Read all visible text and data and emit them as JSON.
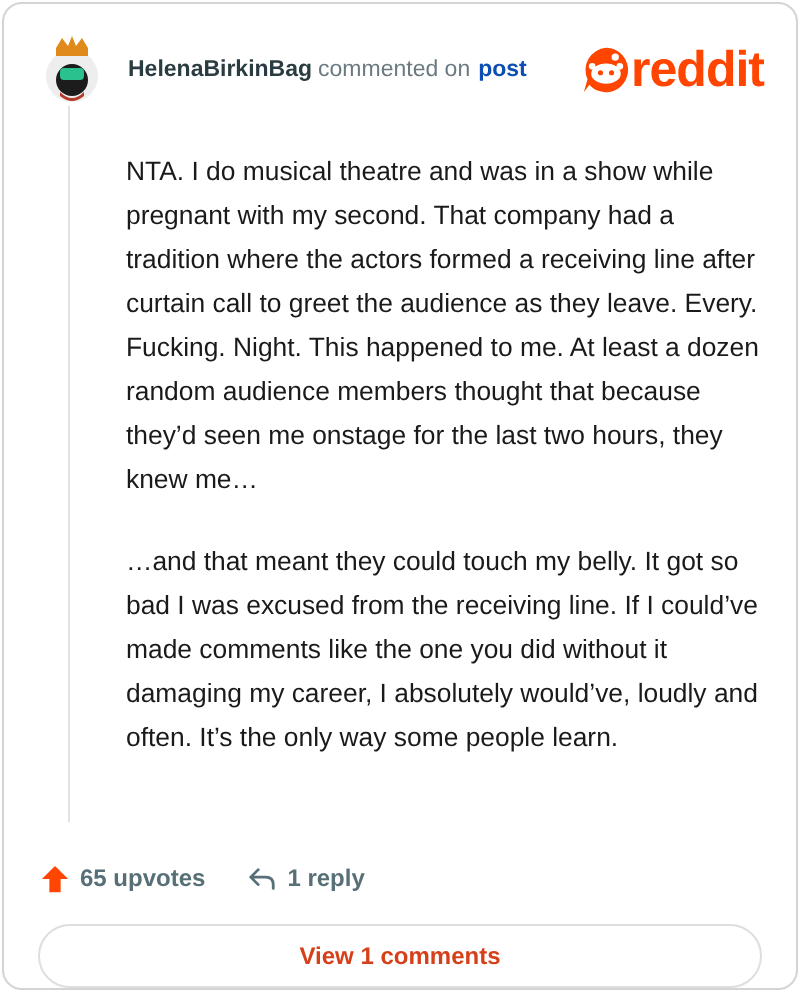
{
  "comment": {
    "author": "HelenaBirkinBag",
    "action": "commented on",
    "link": "post",
    "brand": "reddit",
    "paragraphs": [
      "NTA. I do musical theatre and was in a show while pregnant with my second. That company had a tradition where the actors formed a receiving line after curtain call to greet the audience as they leave. Every. Fucking. Night. This happened to me. At least a dozen random audience members thought that because they’d seen me onstage for the last two hours, they knew me…",
      "…and that meant they could touch my belly. It got so bad I was excused from the receiving line. If I could’ve made comments like the one you did without it damaging my career, I absolutely would’ve, loudly and often. It’s the only way some people learn."
    ],
    "upvotes": "65 upvotes",
    "replies": "1 reply",
    "view_button": "View 1 comments"
  }
}
